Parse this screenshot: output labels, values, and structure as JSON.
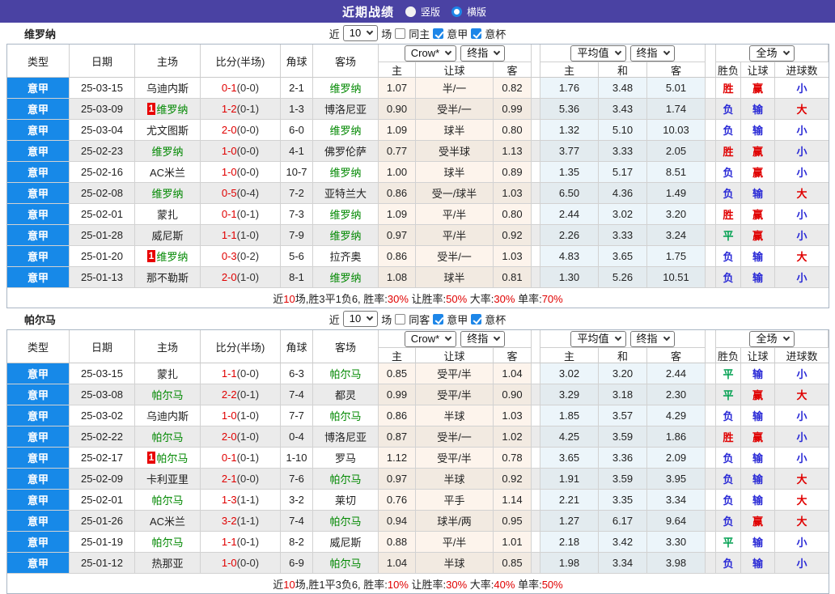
{
  "titlebar": {
    "title": "近期战绩",
    "vertical_label": "竖版",
    "horizontal_label": "横版",
    "selected": "横版"
  },
  "filter": {
    "prefix": "近",
    "count": "10",
    "suffix": "场",
    "league_label": "意甲",
    "cup_label": "意杯"
  },
  "selects": {
    "bookmaker": "Crow*",
    "bookmaker_final": "终指",
    "average": "平均值",
    "average_final": "终指",
    "fulltime": "全场"
  },
  "columns": {
    "type": "类型",
    "date": "日期",
    "home": "主场",
    "score": "比分(半场)",
    "corner": "角球",
    "away": "客场",
    "odds_home": "主",
    "odds_handicap": "让球",
    "odds_away": "客",
    "avg_home": "主",
    "avg_draw": "和",
    "avg_away": "客",
    "result": "胜负",
    "handicap_result": "让球",
    "goals": "进球数"
  },
  "badge_label": "1",
  "colors": {
    "accent_purple": "#4a42a3",
    "league_blue": "#1789e8",
    "team_green": "#008800",
    "score_red": "#e00000",
    "result_red": "#e00000",
    "result_blue": "#2929d6",
    "result_green": "#00a050"
  },
  "sections": [
    {
      "team": "维罗纳",
      "same_label": "同主",
      "rows": [
        {
          "league": "意甲",
          "date": "25-03-15",
          "home": "乌迪内斯",
          "home_badge": false,
          "score": "0-1",
          "half": "(0-0)",
          "corner": "2-1",
          "away": "维罗纳",
          "odds_home": "1.07",
          "handicap": "半/一",
          "odds_away": "0.82",
          "avg_home": "1.76",
          "avg_draw": "3.48",
          "avg_away": "5.01",
          "result": "胜",
          "handicap_result": "赢",
          "goals": "小"
        },
        {
          "league": "意甲",
          "date": "25-03-09",
          "home": "维罗纳",
          "home_badge": true,
          "score": "1-2",
          "half": "(0-1)",
          "corner": "1-3",
          "away": "博洛尼亚",
          "odds_home": "0.90",
          "handicap": "受半/一",
          "odds_away": "0.99",
          "avg_home": "5.36",
          "avg_draw": "3.43",
          "avg_away": "1.74",
          "result": "负",
          "handicap_result": "输",
          "goals": "大"
        },
        {
          "league": "意甲",
          "date": "25-03-04",
          "home": "尤文图斯",
          "home_badge": false,
          "score": "2-0",
          "half": "(0-0)",
          "corner": "6-0",
          "away": "维罗纳",
          "odds_home": "1.09",
          "handicap": "球半",
          "odds_away": "0.80",
          "avg_home": "1.32",
          "avg_draw": "5.10",
          "avg_away": "10.03",
          "result": "负",
          "handicap_result": "输",
          "goals": "小"
        },
        {
          "league": "意甲",
          "date": "25-02-23",
          "home": "维罗纳",
          "home_badge": false,
          "score": "1-0",
          "half": "(0-0)",
          "corner": "4-1",
          "away": "佛罗伦萨",
          "odds_home": "0.77",
          "handicap": "受半球",
          "odds_away": "1.13",
          "avg_home": "3.77",
          "avg_draw": "3.33",
          "avg_away": "2.05",
          "result": "胜",
          "handicap_result": "赢",
          "goals": "小"
        },
        {
          "league": "意甲",
          "date": "25-02-16",
          "home": "AC米兰",
          "home_badge": false,
          "score": "1-0",
          "half": "(0-0)",
          "corner": "10-7",
          "away": "维罗纳",
          "odds_home": "1.00",
          "handicap": "球半",
          "odds_away": "0.89",
          "avg_home": "1.35",
          "avg_draw": "5.17",
          "avg_away": "8.51",
          "result": "负",
          "handicap_result": "赢",
          "goals": "小"
        },
        {
          "league": "意甲",
          "date": "25-02-08",
          "home": "维罗纳",
          "home_badge": false,
          "score": "0-5",
          "half": "(0-4)",
          "corner": "7-2",
          "away": "亚特兰大",
          "odds_home": "0.86",
          "handicap": "受一/球半",
          "odds_away": "1.03",
          "avg_home": "6.50",
          "avg_draw": "4.36",
          "avg_away": "1.49",
          "result": "负",
          "handicap_result": "输",
          "goals": "大"
        },
        {
          "league": "意甲",
          "date": "25-02-01",
          "home": "蒙扎",
          "home_badge": false,
          "score": "0-1",
          "half": "(0-1)",
          "corner": "7-3",
          "away": "维罗纳",
          "odds_home": "1.09",
          "handicap": "平/半",
          "odds_away": "0.80",
          "avg_home": "2.44",
          "avg_draw": "3.02",
          "avg_away": "3.20",
          "result": "胜",
          "handicap_result": "赢",
          "goals": "小"
        },
        {
          "league": "意甲",
          "date": "25-01-28",
          "home": "威尼斯",
          "home_badge": false,
          "score": "1-1",
          "half": "(1-0)",
          "corner": "7-9",
          "away": "维罗纳",
          "odds_home": "0.97",
          "handicap": "平/半",
          "odds_away": "0.92",
          "avg_home": "2.26",
          "avg_draw": "3.33",
          "avg_away": "3.24",
          "result": "平",
          "handicap_result": "赢",
          "goals": "小"
        },
        {
          "league": "意甲",
          "date": "25-01-20",
          "home": "维罗纳",
          "home_badge": true,
          "score": "0-3",
          "half": "(0-2)",
          "corner": "5-6",
          "away": "拉齐奥",
          "odds_home": "0.86",
          "handicap": "受半/一",
          "odds_away": "1.03",
          "avg_home": "4.83",
          "avg_draw": "3.65",
          "avg_away": "1.75",
          "result": "负",
          "handicap_result": "输",
          "goals": "大"
        },
        {
          "league": "意甲",
          "date": "25-01-13",
          "home": "那不勒斯",
          "home_badge": false,
          "score": "2-0",
          "half": "(1-0)",
          "corner": "8-1",
          "away": "维罗纳",
          "odds_home": "1.08",
          "handicap": "球半",
          "odds_away": "0.81",
          "avg_home": "1.30",
          "avg_draw": "5.26",
          "avg_away": "10.51",
          "result": "负",
          "handicap_result": "输",
          "goals": "小"
        }
      ],
      "summary": [
        {
          "t": "近"
        },
        {
          "t": "10",
          "red": true
        },
        {
          "t": "场,胜3平1负6, 胜率:"
        },
        {
          "t": "30%",
          "red": true
        },
        {
          "t": " 让胜率:"
        },
        {
          "t": "50%",
          "red": true
        },
        {
          "t": " 大率:"
        },
        {
          "t": "30%",
          "red": true
        },
        {
          "t": " 单率:"
        },
        {
          "t": "70%",
          "red": true
        }
      ]
    },
    {
      "team": "帕尔马",
      "same_label": "同客",
      "rows": [
        {
          "league": "意甲",
          "date": "25-03-15",
          "home": "蒙扎",
          "home_badge": false,
          "score": "1-1",
          "half": "(0-0)",
          "corner": "6-3",
          "away": "帕尔马",
          "odds_home": "0.85",
          "handicap": "受平/半",
          "odds_away": "1.04",
          "avg_home": "3.02",
          "avg_draw": "3.20",
          "avg_away": "2.44",
          "result": "平",
          "handicap_result": "输",
          "goals": "小"
        },
        {
          "league": "意甲",
          "date": "25-03-08",
          "home": "帕尔马",
          "home_badge": false,
          "score": "2-2",
          "half": "(0-1)",
          "corner": "7-4",
          "away": "都灵",
          "odds_home": "0.99",
          "handicap": "受平/半",
          "odds_away": "0.90",
          "avg_home": "3.29",
          "avg_draw": "3.18",
          "avg_away": "2.30",
          "result": "平",
          "handicap_result": "赢",
          "goals": "大"
        },
        {
          "league": "意甲",
          "date": "25-03-02",
          "home": "乌迪内斯",
          "home_badge": false,
          "score": "1-0",
          "half": "(1-0)",
          "corner": "7-7",
          "away": "帕尔马",
          "odds_home": "0.86",
          "handicap": "半球",
          "odds_away": "1.03",
          "avg_home": "1.85",
          "avg_draw": "3.57",
          "avg_away": "4.29",
          "result": "负",
          "handicap_result": "输",
          "goals": "小"
        },
        {
          "league": "意甲",
          "date": "25-02-22",
          "home": "帕尔马",
          "home_badge": false,
          "score": "2-0",
          "half": "(1-0)",
          "corner": "0-4",
          "away": "博洛尼亚",
          "odds_home": "0.87",
          "handicap": "受半/一",
          "odds_away": "1.02",
          "avg_home": "4.25",
          "avg_draw": "3.59",
          "avg_away": "1.86",
          "result": "胜",
          "handicap_result": "赢",
          "goals": "小"
        },
        {
          "league": "意甲",
          "date": "25-02-17",
          "home": "帕尔马",
          "home_badge": true,
          "score": "0-1",
          "half": "(0-1)",
          "corner": "1-10",
          "away": "罗马",
          "odds_home": "1.12",
          "handicap": "受平/半",
          "odds_away": "0.78",
          "avg_home": "3.65",
          "avg_draw": "3.36",
          "avg_away": "2.09",
          "result": "负",
          "handicap_result": "输",
          "goals": "小"
        },
        {
          "league": "意甲",
          "date": "25-02-09",
          "home": "卡利亚里",
          "home_badge": false,
          "score": "2-1",
          "half": "(0-0)",
          "corner": "7-6",
          "away": "帕尔马",
          "odds_home": "0.97",
          "handicap": "半球",
          "odds_away": "0.92",
          "avg_home": "1.91",
          "avg_draw": "3.59",
          "avg_away": "3.95",
          "result": "负",
          "handicap_result": "输",
          "goals": "大"
        },
        {
          "league": "意甲",
          "date": "25-02-01",
          "home": "帕尔马",
          "home_badge": false,
          "score": "1-3",
          "half": "(1-1)",
          "corner": "3-2",
          "away": "莱切",
          "odds_home": "0.76",
          "handicap": "平手",
          "odds_away": "1.14",
          "avg_home": "2.21",
          "avg_draw": "3.35",
          "avg_away": "3.34",
          "result": "负",
          "handicap_result": "输",
          "goals": "大"
        },
        {
          "league": "意甲",
          "date": "25-01-26",
          "home": "AC米兰",
          "home_badge": false,
          "score": "3-2",
          "half": "(1-1)",
          "corner": "7-4",
          "away": "帕尔马",
          "odds_home": "0.94",
          "handicap": "球半/两",
          "odds_away": "0.95",
          "avg_home": "1.27",
          "avg_draw": "6.17",
          "avg_away": "9.64",
          "result": "负",
          "handicap_result": "赢",
          "goals": "大"
        },
        {
          "league": "意甲",
          "date": "25-01-19",
          "home": "帕尔马",
          "home_badge": false,
          "score": "1-1",
          "half": "(0-1)",
          "corner": "8-2",
          "away": "威尼斯",
          "odds_home": "0.88",
          "handicap": "平/半",
          "odds_away": "1.01",
          "avg_home": "2.18",
          "avg_draw": "3.42",
          "avg_away": "3.30",
          "result": "平",
          "handicap_result": "输",
          "goals": "小"
        },
        {
          "league": "意甲",
          "date": "25-01-12",
          "home": "热那亚",
          "home_badge": false,
          "score": "1-0",
          "half": "(0-0)",
          "corner": "6-9",
          "away": "帕尔马",
          "odds_home": "1.04",
          "handicap": "半球",
          "odds_away": "0.85",
          "avg_home": "1.98",
          "avg_draw": "3.34",
          "avg_away": "3.98",
          "result": "负",
          "handicap_result": "输",
          "goals": "小"
        }
      ],
      "summary": [
        {
          "t": "近"
        },
        {
          "t": "10",
          "red": true
        },
        {
          "t": "场,胜1平3负6, 胜率:"
        },
        {
          "t": "10%",
          "red": true
        },
        {
          "t": " 让胜率:"
        },
        {
          "t": "30%",
          "red": true
        },
        {
          "t": " 大率:"
        },
        {
          "t": "40%",
          "red": true
        },
        {
          "t": " 单率:"
        },
        {
          "t": "50%",
          "red": true
        }
      ]
    }
  ]
}
